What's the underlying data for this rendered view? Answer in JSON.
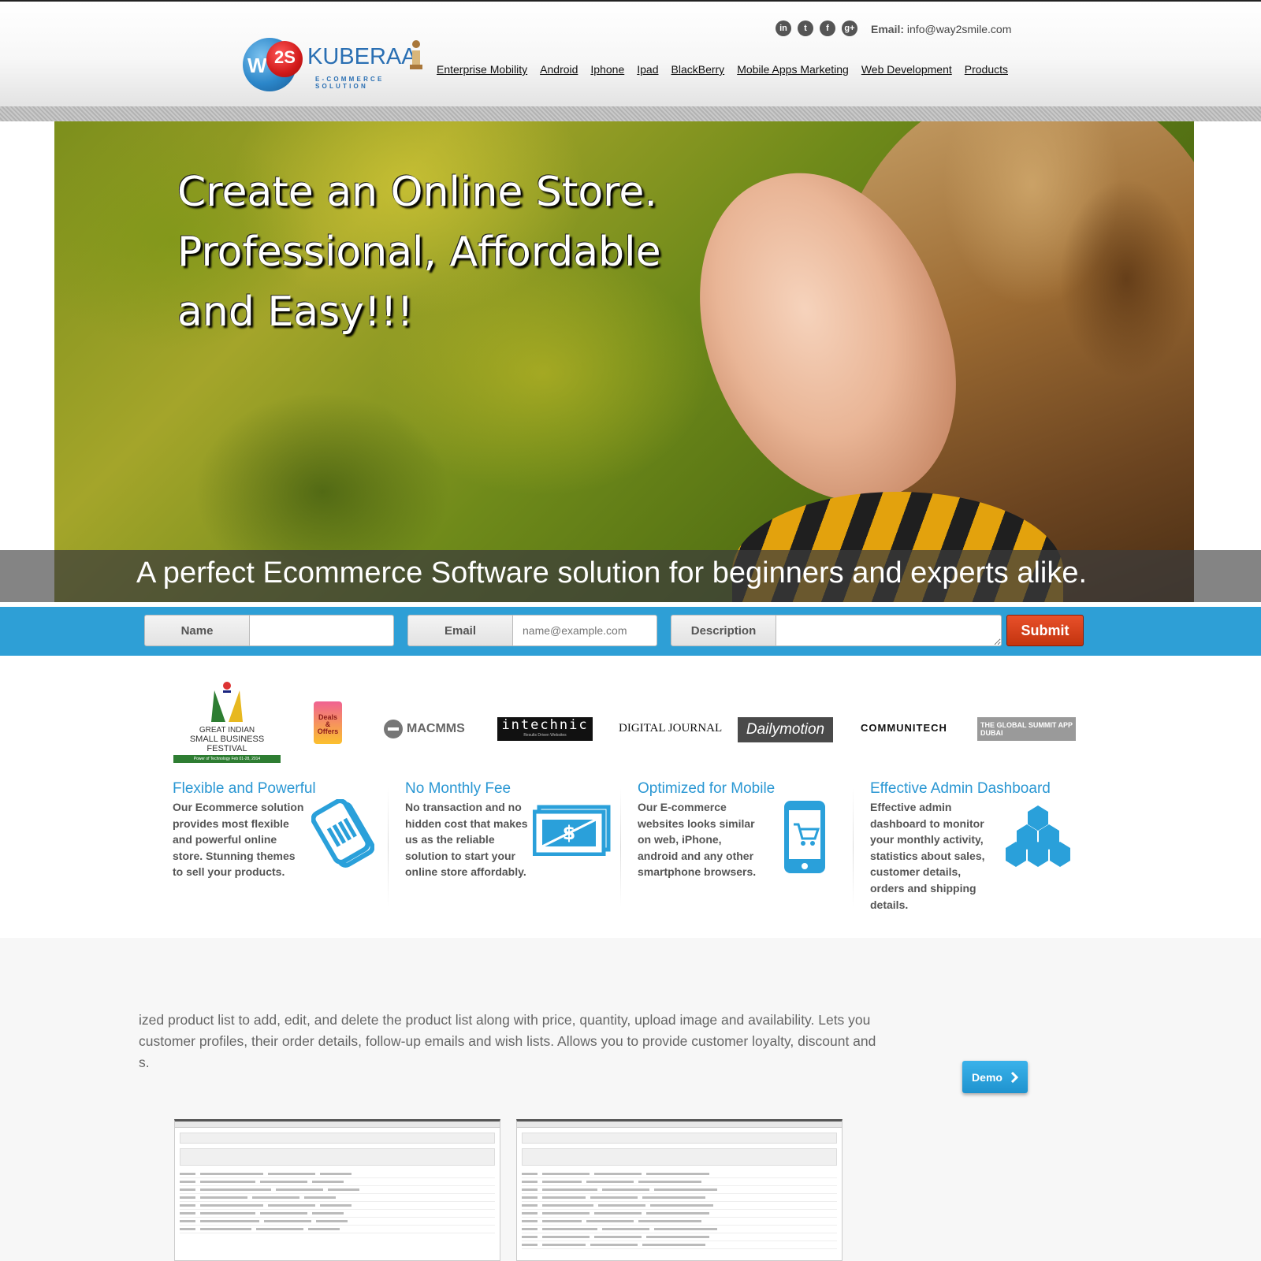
{
  "header": {
    "logo": {
      "mark": "W",
      "mark2": "2S",
      "name": "KUBERAA",
      "tagline": "E-COMMERCE SOLUTION"
    },
    "social": [
      {
        "icon": "linkedin-icon",
        "glyph": "in"
      },
      {
        "icon": "twitter-icon",
        "glyph": "t"
      },
      {
        "icon": "facebook-icon",
        "glyph": "f"
      },
      {
        "icon": "google-plus-icon",
        "glyph": "g+"
      }
    ],
    "email_label": "Email:",
    "email_value": "info@way2smile.com",
    "nav": [
      "Enterprise Mobility",
      "Android",
      "Iphone",
      "Ipad",
      "BlackBerry",
      "Mobile Apps Marketing",
      "Web Development",
      "Products"
    ]
  },
  "hero": {
    "title_lines": [
      "Create an Online Store.",
      "Professional, Affordable",
      "and Easy!!!"
    ],
    "subtitle": "A perfect Ecommerce Software solution for beginners and experts alike."
  },
  "form": {
    "name_label": "Name",
    "name_value": "",
    "email_label": "Email",
    "email_placeholder": "name@example.com",
    "description_label": "Description",
    "description_value": "",
    "submit_label": "Submit"
  },
  "partners": [
    {
      "name": "great-indian-small-business-festival-logo",
      "line1": "GREAT INDIAN",
      "line2": "SMALL BUSINESS FESTIVAL",
      "line3": "Power of Technology   Feb 01-28, 2014"
    },
    {
      "name": "deals-and-offers-logo",
      "line1": "Deals",
      "line2": "&",
      "line3": "Offers"
    },
    {
      "name": "macmms-logo",
      "text": "MACMMS"
    },
    {
      "name": "intechnic-logo",
      "text": "intechnic",
      "sub": "Results Driven Websites"
    },
    {
      "name": "digital-journal-logo",
      "text": "DIGITAL JOURNAL"
    },
    {
      "name": "dailymotion-logo",
      "text": "Dailymotion"
    },
    {
      "name": "communitech-logo",
      "text": "COMMUNITECH"
    },
    {
      "name": "global-summit-app-dubai-logo",
      "text": "THE GLOBAL SUMMIT APP DUBAI"
    }
  ],
  "features": [
    {
      "title": "Flexible and Powerful",
      "text": "Our Ecommerce solution provides most flexible and powerful online store. Stunning themes to sell your products.",
      "icon": "tags-icon"
    },
    {
      "title": "No Monthly Fee",
      "text": "No transaction and no hidden cost that makes us as the reliable solution to start your online store affordably.",
      "icon": "money-icon"
    },
    {
      "title": "Optimized for Mobile",
      "text": "Our E-commerce websites looks similar on web, iPhone, android and any other smartphone browsers.",
      "icon": "mobile-cart-icon"
    },
    {
      "title": "Effective Admin Dashboard",
      "text": "Effective admin dashboard to monitor your monthly activity, statistics about sales, customer details, orders and shipping details.",
      "icon": "hexagons-icon"
    }
  ],
  "lower": {
    "lines": [
      "ized product list to add, edit, and delete the product list along with price, quantity, upload image and availability. Lets you",
      "customer profiles, their order details, follow-up emails and wish lists. Allows you to provide customer loyalty, discount and",
      "s."
    ],
    "demo_label": "Demo"
  },
  "colors": {
    "accent_blue": "#2e9fd6",
    "submit_red": "#d23e18",
    "feature_title": "#2a97d3"
  }
}
